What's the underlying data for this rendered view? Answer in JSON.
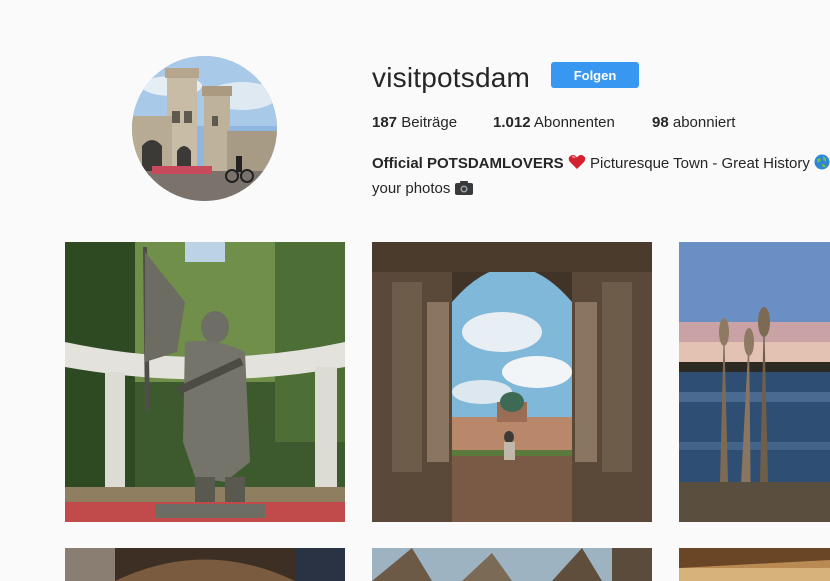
{
  "profile": {
    "username": "visitpotsdam",
    "follow_label": "Folgen",
    "stats": {
      "posts_count": "187",
      "posts_label": "Beiträge",
      "followers_count": "1.012",
      "followers_label": "Abonnenten",
      "following_count": "98",
      "following_label": "abonniert"
    },
    "bio": {
      "name": "Official POTSDAMLOVERS",
      "text": "Picturesque Town - Great History",
      "line2": "your photos"
    }
  },
  "icons": [
    "heart-icon",
    "globe-icon",
    "camera-icon"
  ],
  "colors": {
    "follow_button": "#3897f0",
    "background": "#fafafa"
  }
}
